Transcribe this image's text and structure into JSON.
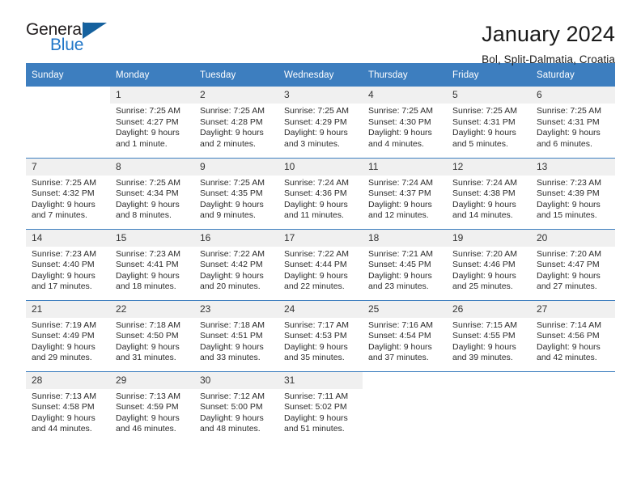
{
  "brand": {
    "name_part1": "General",
    "name_part2": "Blue",
    "triangle_color": "#15619e",
    "blue_color": "#2277c8"
  },
  "header": {
    "title": "January 2024",
    "subtitle": "Bol, Split-Dalmatia, Croatia"
  },
  "theme": {
    "header_background": "#3d7ebf",
    "header_text": "#ffffff",
    "daynum_background": "#f0f0f0",
    "page_background": "#ffffff"
  },
  "calendar": {
    "weekday_headers": [
      "Sunday",
      "Monday",
      "Tuesday",
      "Wednesday",
      "Thursday",
      "Friday",
      "Saturday"
    ],
    "weeks": [
      [
        {
          "day": "",
          "sunrise": "",
          "sunset": "",
          "daylight1": "",
          "daylight2": ""
        },
        {
          "day": "1",
          "sunrise": "Sunrise: 7:25 AM",
          "sunset": "Sunset: 4:27 PM",
          "daylight1": "Daylight: 9 hours",
          "daylight2": "and 1 minute."
        },
        {
          "day": "2",
          "sunrise": "Sunrise: 7:25 AM",
          "sunset": "Sunset: 4:28 PM",
          "daylight1": "Daylight: 9 hours",
          "daylight2": "and 2 minutes."
        },
        {
          "day": "3",
          "sunrise": "Sunrise: 7:25 AM",
          "sunset": "Sunset: 4:29 PM",
          "daylight1": "Daylight: 9 hours",
          "daylight2": "and 3 minutes."
        },
        {
          "day": "4",
          "sunrise": "Sunrise: 7:25 AM",
          "sunset": "Sunset: 4:30 PM",
          "daylight1": "Daylight: 9 hours",
          "daylight2": "and 4 minutes."
        },
        {
          "day": "5",
          "sunrise": "Sunrise: 7:25 AM",
          "sunset": "Sunset: 4:31 PM",
          "daylight1": "Daylight: 9 hours",
          "daylight2": "and 5 minutes."
        },
        {
          "day": "6",
          "sunrise": "Sunrise: 7:25 AM",
          "sunset": "Sunset: 4:31 PM",
          "daylight1": "Daylight: 9 hours",
          "daylight2": "and 6 minutes."
        }
      ],
      [
        {
          "day": "7",
          "sunrise": "Sunrise: 7:25 AM",
          "sunset": "Sunset: 4:32 PM",
          "daylight1": "Daylight: 9 hours",
          "daylight2": "and 7 minutes."
        },
        {
          "day": "8",
          "sunrise": "Sunrise: 7:25 AM",
          "sunset": "Sunset: 4:34 PM",
          "daylight1": "Daylight: 9 hours",
          "daylight2": "and 8 minutes."
        },
        {
          "day": "9",
          "sunrise": "Sunrise: 7:25 AM",
          "sunset": "Sunset: 4:35 PM",
          "daylight1": "Daylight: 9 hours",
          "daylight2": "and 9 minutes."
        },
        {
          "day": "10",
          "sunrise": "Sunrise: 7:24 AM",
          "sunset": "Sunset: 4:36 PM",
          "daylight1": "Daylight: 9 hours",
          "daylight2": "and 11 minutes."
        },
        {
          "day": "11",
          "sunrise": "Sunrise: 7:24 AM",
          "sunset": "Sunset: 4:37 PM",
          "daylight1": "Daylight: 9 hours",
          "daylight2": "and 12 minutes."
        },
        {
          "day": "12",
          "sunrise": "Sunrise: 7:24 AM",
          "sunset": "Sunset: 4:38 PM",
          "daylight1": "Daylight: 9 hours",
          "daylight2": "and 14 minutes."
        },
        {
          "day": "13",
          "sunrise": "Sunrise: 7:23 AM",
          "sunset": "Sunset: 4:39 PM",
          "daylight1": "Daylight: 9 hours",
          "daylight2": "and 15 minutes."
        }
      ],
      [
        {
          "day": "14",
          "sunrise": "Sunrise: 7:23 AM",
          "sunset": "Sunset: 4:40 PM",
          "daylight1": "Daylight: 9 hours",
          "daylight2": "and 17 minutes."
        },
        {
          "day": "15",
          "sunrise": "Sunrise: 7:23 AM",
          "sunset": "Sunset: 4:41 PM",
          "daylight1": "Daylight: 9 hours",
          "daylight2": "and 18 minutes."
        },
        {
          "day": "16",
          "sunrise": "Sunrise: 7:22 AM",
          "sunset": "Sunset: 4:42 PM",
          "daylight1": "Daylight: 9 hours",
          "daylight2": "and 20 minutes."
        },
        {
          "day": "17",
          "sunrise": "Sunrise: 7:22 AM",
          "sunset": "Sunset: 4:44 PM",
          "daylight1": "Daylight: 9 hours",
          "daylight2": "and 22 minutes."
        },
        {
          "day": "18",
          "sunrise": "Sunrise: 7:21 AM",
          "sunset": "Sunset: 4:45 PM",
          "daylight1": "Daylight: 9 hours",
          "daylight2": "and 23 minutes."
        },
        {
          "day": "19",
          "sunrise": "Sunrise: 7:20 AM",
          "sunset": "Sunset: 4:46 PM",
          "daylight1": "Daylight: 9 hours",
          "daylight2": "and 25 minutes."
        },
        {
          "day": "20",
          "sunrise": "Sunrise: 7:20 AM",
          "sunset": "Sunset: 4:47 PM",
          "daylight1": "Daylight: 9 hours",
          "daylight2": "and 27 minutes."
        }
      ],
      [
        {
          "day": "21",
          "sunrise": "Sunrise: 7:19 AM",
          "sunset": "Sunset: 4:49 PM",
          "daylight1": "Daylight: 9 hours",
          "daylight2": "and 29 minutes."
        },
        {
          "day": "22",
          "sunrise": "Sunrise: 7:18 AM",
          "sunset": "Sunset: 4:50 PM",
          "daylight1": "Daylight: 9 hours",
          "daylight2": "and 31 minutes."
        },
        {
          "day": "23",
          "sunrise": "Sunrise: 7:18 AM",
          "sunset": "Sunset: 4:51 PM",
          "daylight1": "Daylight: 9 hours",
          "daylight2": "and 33 minutes."
        },
        {
          "day": "24",
          "sunrise": "Sunrise: 7:17 AM",
          "sunset": "Sunset: 4:53 PM",
          "daylight1": "Daylight: 9 hours",
          "daylight2": "and 35 minutes."
        },
        {
          "day": "25",
          "sunrise": "Sunrise: 7:16 AM",
          "sunset": "Sunset: 4:54 PM",
          "daylight1": "Daylight: 9 hours",
          "daylight2": "and 37 minutes."
        },
        {
          "day": "26",
          "sunrise": "Sunrise: 7:15 AM",
          "sunset": "Sunset: 4:55 PM",
          "daylight1": "Daylight: 9 hours",
          "daylight2": "and 39 minutes."
        },
        {
          "day": "27",
          "sunrise": "Sunrise: 7:14 AM",
          "sunset": "Sunset: 4:56 PM",
          "daylight1": "Daylight: 9 hours",
          "daylight2": "and 42 minutes."
        }
      ],
      [
        {
          "day": "28",
          "sunrise": "Sunrise: 7:13 AM",
          "sunset": "Sunset: 4:58 PM",
          "daylight1": "Daylight: 9 hours",
          "daylight2": "and 44 minutes."
        },
        {
          "day": "29",
          "sunrise": "Sunrise: 7:13 AM",
          "sunset": "Sunset: 4:59 PM",
          "daylight1": "Daylight: 9 hours",
          "daylight2": "and 46 minutes."
        },
        {
          "day": "30",
          "sunrise": "Sunrise: 7:12 AM",
          "sunset": "Sunset: 5:00 PM",
          "daylight1": "Daylight: 9 hours",
          "daylight2": "and 48 minutes."
        },
        {
          "day": "31",
          "sunrise": "Sunrise: 7:11 AM",
          "sunset": "Sunset: 5:02 PM",
          "daylight1": "Daylight: 9 hours",
          "daylight2": "and 51 minutes."
        },
        {
          "day": "",
          "sunrise": "",
          "sunset": "",
          "daylight1": "",
          "daylight2": ""
        },
        {
          "day": "",
          "sunrise": "",
          "sunset": "",
          "daylight1": "",
          "daylight2": ""
        },
        {
          "day": "",
          "sunrise": "",
          "sunset": "",
          "daylight1": "",
          "daylight2": ""
        }
      ]
    ]
  }
}
